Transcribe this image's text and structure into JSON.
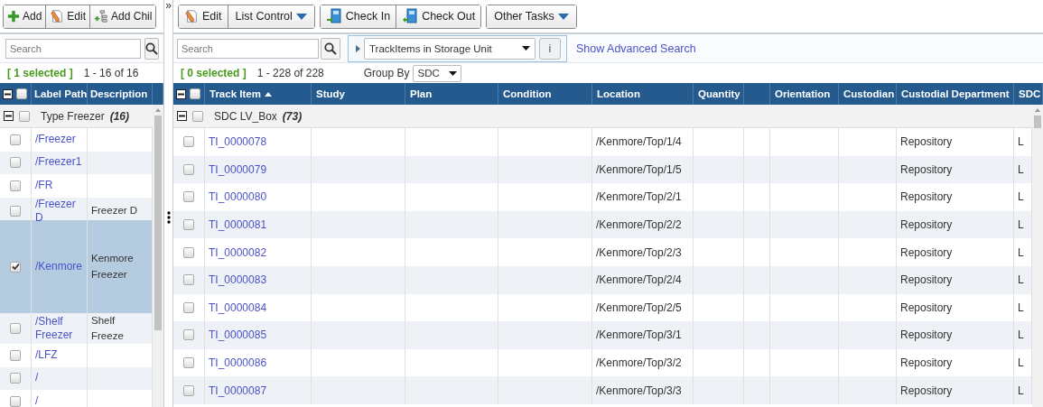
{
  "left_panel": {
    "toolbar": [
      {
        "label": "Add"
      },
      {
        "label": "Edit"
      },
      {
        "label": "Add Chil"
      }
    ],
    "collapse_toggle": "»",
    "search": {
      "placeholder": "Search"
    },
    "status": {
      "selected": "[ 1 selected ]",
      "range": "1 - 16 of 16"
    },
    "select_all": {
      "checked": false
    },
    "columns": [
      "Label Path",
      "Description"
    ],
    "group": {
      "label": "Type Freezer",
      "count": "(16)",
      "expanded": true,
      "checked": false
    },
    "rows": [
      {
        "label_path": "/Freezer",
        "selected": false
      },
      {
        "label_path": "/Freezer1",
        "selected": false
      },
      {
        "label_path": "/FR",
        "selected": false
      },
      {
        "label_path": "/Freezer D",
        "description": "Freezer D",
        "selected": false
      },
      {
        "label_path": "/Kenmore",
        "description": "Kenmore Freezer",
        "selected": true
      },
      {
        "label_path": "/Shelf Freezer",
        "description": "Shelf Freeze",
        "selected": false
      },
      {
        "label_path": "/LFZ",
        "selected": false
      },
      {
        "label_path": "/",
        "selected": false
      },
      {
        "label_path": "/",
        "selected": false
      }
    ]
  },
  "right_panel": {
    "toolbar": [
      [
        {
          "label": "Edit",
          "kind": "button"
        },
        {
          "label": "List Control",
          "kind": "dropdown"
        }
      ],
      [
        {
          "label": "Check In",
          "kind": "button"
        },
        {
          "label": "Check Out",
          "kind": "button"
        }
      ],
      [
        {
          "label": "Other Tasks",
          "kind": "dropdown"
        }
      ]
    ],
    "search": {
      "placeholder": "Search"
    },
    "saved_search": {
      "value": "TrackItems in Storage Unit",
      "info": "i"
    },
    "advanced_link": "Show Advanced Search",
    "status": {
      "selected": "[ 0 selected ]",
      "range": "1 - 228 of 228"
    },
    "group_by": {
      "label": "Group By",
      "value": "SDC"
    },
    "select_all": {
      "checked": false
    },
    "columns": [
      {
        "label": "Track Item",
        "sorted_ascending": true
      },
      {
        "label": "Study"
      },
      {
        "label": "Plan"
      },
      {
        "label": "Condition"
      },
      {
        "label": "Location"
      },
      {
        "label": "Quantity"
      },
      {},
      {
        "label": "Orientation"
      },
      {
        "label": "Custodian"
      },
      {
        "label": "Custodial Department"
      },
      {
        "label": "SDC"
      }
    ],
    "group": {
      "label": "SDC LV_Box",
      "count": "(73)",
      "expanded": true,
      "checked": false
    },
    "rows": [
      {
        "track_item": "TI_0000078",
        "location": "/Kenmore/Top/1/4",
        "custodial_department": "Repository",
        "column_11": "L",
        "selected": false
      },
      {
        "track_item": "TI_0000079",
        "location": "/Kenmore/Top/1/5",
        "custodial_department": "Repository",
        "column_11": "L",
        "selected": false
      },
      {
        "track_item": "TI_0000080",
        "location": "/Kenmore/Top/2/1",
        "custodial_department": "Repository",
        "column_11": "L",
        "selected": false
      },
      {
        "track_item": "TI_0000081",
        "location": "/Kenmore/Top/2/2",
        "custodial_department": "Repository",
        "column_11": "L",
        "selected": false
      },
      {
        "track_item": "TI_0000082",
        "location": "/Kenmore/Top/2/3",
        "custodial_department": "Repository",
        "column_11": "L",
        "selected": false
      },
      {
        "track_item": "TI_0000083",
        "location": "/Kenmore/Top/2/4",
        "custodial_department": "Repository",
        "column_11": "L",
        "selected": false
      },
      {
        "track_item": "TI_0000084",
        "location": "/Kenmore/Top/2/5",
        "custodial_department": "Repository",
        "column_11": "L",
        "selected": false
      },
      {
        "track_item": "TI_0000085",
        "location": "/Kenmore/Top/3/1",
        "custodial_department": "Repository",
        "column_11": "L",
        "selected": false
      },
      {
        "track_item": "TI_0000086",
        "location": "/Kenmore/Top/3/2",
        "custodial_department": "Repository",
        "column_11": "L",
        "selected": false
      },
      {
        "track_item": "TI_0000087",
        "location": "/Kenmore/Top/3/3",
        "custodial_department": "Repository",
        "column_11": "L",
        "selected": false
      }
    ]
  }
}
